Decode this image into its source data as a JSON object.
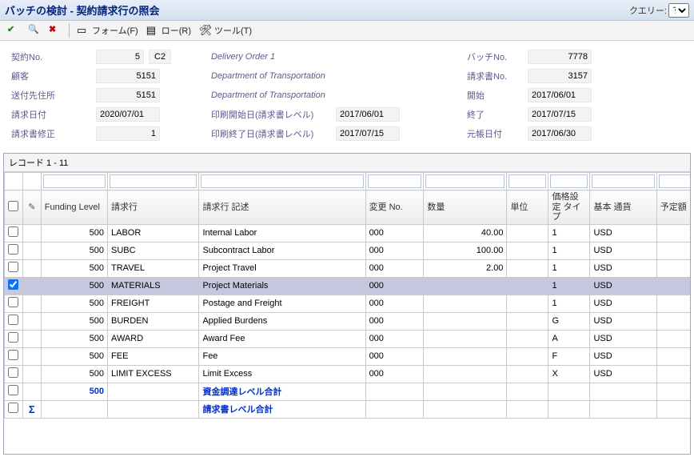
{
  "title": "バッチの検討 - 契約請求行の照会",
  "query_label": "クエリー:",
  "query_value": "す",
  "toolbar": {
    "form_label": "フォーム(F)",
    "row_label": "ロー(R)",
    "tool_label": "ツール(T)"
  },
  "form": {
    "contract_no_label": "契約No.",
    "contract_no_value": "5",
    "contract_tag": "C2",
    "delivery_text": "Delivery Order 1",
    "batch_no_label": "バッチNo.",
    "batch_no_value": "7778",
    "customer_label": "顧客",
    "customer_value": "5151",
    "dept_text": "Department of Transportation",
    "docno_label": "請求書No.",
    "docno_value": "3157",
    "shipto_label": "送付先住所",
    "shipto_value": "5151",
    "open_label": "開始",
    "open_value": "2017/06/01",
    "invdate_label": "請求日付",
    "invdate_value": "2020/07/01",
    "print_from_label": "印刷開始日(請求書レベル)",
    "print_from_value": "2017/06/01",
    "end_label": "終了",
    "end_value": "2017/07/15",
    "inv_adj_label": "請求書修正",
    "inv_adj_value": "1",
    "print_to_label": "印刷終了日(請求書レベル)",
    "print_to_value": "2017/07/15",
    "gl_date_label": "元帳日付",
    "gl_date_value": "2017/06/30"
  },
  "grid": {
    "records_text": "レコード 1 - 11",
    "headers": {
      "funding": "Funding\nLevel",
      "billing_line": "請求行",
      "billing_desc": "請求行\n記述",
      "change_no": "変更\nNo.",
      "qty": "数量",
      "unit": "単位",
      "price_type": "価格設\n定\nタイプ",
      "currency": "基本\n通貨",
      "amount": "予定額"
    },
    "rows": [
      {
        "funding": "500",
        "line": "LABOR",
        "desc": "Internal Labor",
        "chg": "000",
        "qty": "40.00",
        "unit": "",
        "ptype": "1",
        "cur": "USD",
        "sel": false
      },
      {
        "funding": "500",
        "line": "SUBC",
        "desc": "Subcontract Labor",
        "chg": "000",
        "qty": "100.00",
        "unit": "",
        "ptype": "1",
        "cur": "USD",
        "sel": false
      },
      {
        "funding": "500",
        "line": "TRAVEL",
        "desc": "Project Travel",
        "chg": "000",
        "qty": "2.00",
        "unit": "",
        "ptype": "1",
        "cur": "USD",
        "sel": false
      },
      {
        "funding": "500",
        "line": "MATERIALS",
        "desc": "Project Materials",
        "chg": "000",
        "qty": "",
        "unit": "",
        "ptype": "1",
        "cur": "USD",
        "sel": true
      },
      {
        "funding": "500",
        "line": "FREIGHT",
        "desc": "Postage and Freight",
        "chg": "000",
        "qty": "",
        "unit": "",
        "ptype": "1",
        "cur": "USD",
        "sel": false
      },
      {
        "funding": "500",
        "line": "BURDEN",
        "desc": "Applied Burdens",
        "chg": "000",
        "qty": "",
        "unit": "",
        "ptype": "G",
        "cur": "USD",
        "sel": false
      },
      {
        "funding": "500",
        "line": "AWARD",
        "desc": " Award Fee",
        "chg": "000",
        "qty": "",
        "unit": "",
        "ptype": "A",
        "cur": "USD",
        "sel": false
      },
      {
        "funding": "500",
        "line": "FEE",
        "desc": "Fee",
        "chg": "000",
        "qty": "",
        "unit": "",
        "ptype": "F",
        "cur": "USD",
        "sel": false
      },
      {
        "funding": "500",
        "line": "LIMIT EXCESS",
        "desc": "Limit Excess",
        "chg": "000",
        "qty": "",
        "unit": "",
        "ptype": "X",
        "cur": "USD",
        "sel": false
      }
    ],
    "totals": {
      "funding_row_funding": "500",
      "funding_row_desc": "資金調達レベル合計",
      "invoice_row_desc": "請求書レベル合計"
    }
  }
}
